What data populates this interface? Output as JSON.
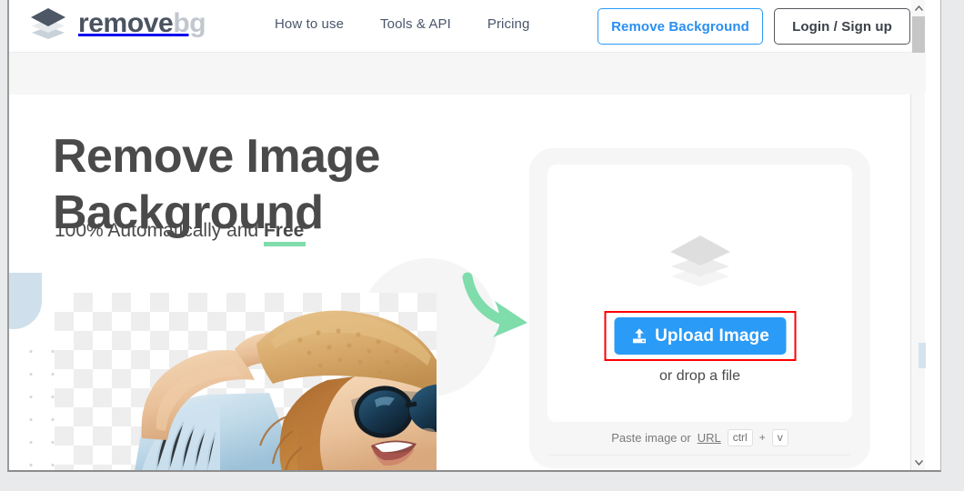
{
  "browser": {
    "scrollbar": {
      "up_arrow": "▲",
      "down_arrow": "▼"
    }
  },
  "header": {
    "logo": {
      "icon": "layers-stack-icon",
      "primary": "remove",
      "secondary": "bg"
    },
    "nav": [
      {
        "label": "How to use"
      },
      {
        "label": "Tools & API"
      },
      {
        "label": "Pricing"
      }
    ],
    "actions": {
      "remove_background": "Remove Background",
      "login_signup": "Login / Sign up"
    }
  },
  "hero": {
    "title_line1": "Remove Image",
    "title_line2": "Background",
    "subtitle_prefix": "100% Automatically and ",
    "subtitle_highlight": "Free"
  },
  "upload": {
    "stack_icon": "layers-stack-icon",
    "button_label": "Upload Image",
    "button_icon": "upload-arrow-icon",
    "drop_hint": "or drop a file",
    "paste_label": "Paste image or ",
    "paste_url_label": "URL",
    "shortcut_key1": "ctrl",
    "shortcut_plus": "+",
    "shortcut_key2": "v"
  },
  "colors": {
    "accent_blue": "#2a9bf7",
    "highlight_red": "#fe0000",
    "green_arrow": "#7fdcab",
    "logo_dark": "#4a5360",
    "logo_light": "#c2c7ce",
    "band_gray": "#f6f6f7",
    "deco_blue": "#cfe0ec"
  }
}
